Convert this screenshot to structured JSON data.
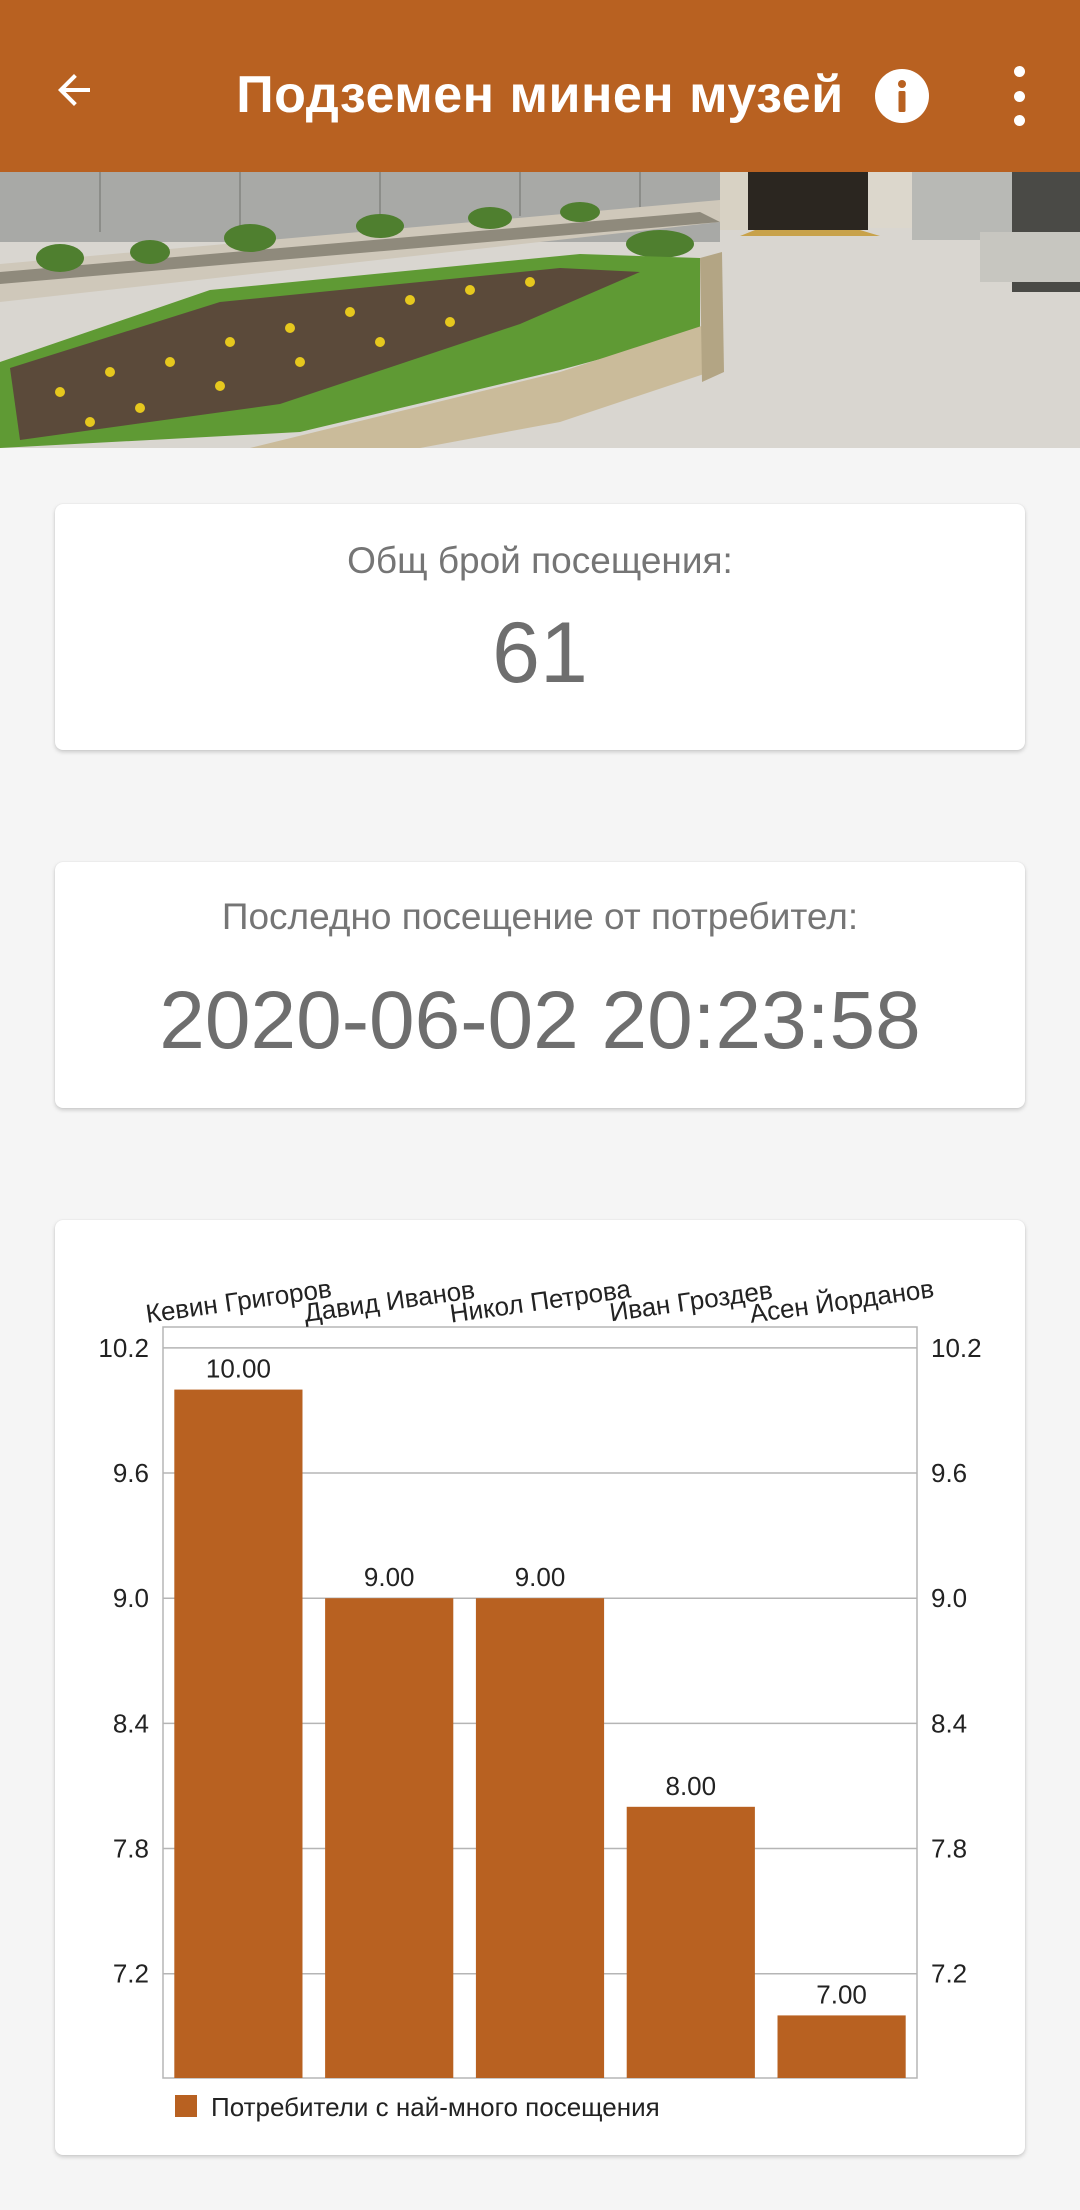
{
  "appbar": {
    "title": "Подземен минен музей",
    "back_icon": "arrow-left-icon",
    "info_icon": "info-icon",
    "more_icon": "more-vert-icon",
    "background": "#b86121"
  },
  "total_card": {
    "label": "Общ брой посещения:",
    "value": "61"
  },
  "last_visit_card": {
    "label": "Последно посещение от потребител:",
    "value": "2020-06-02 20:23:58"
  },
  "chart_data": {
    "type": "bar",
    "categories": [
      "Кевин Григоров",
      "Давид Иванов",
      "Никол Петрова",
      "Иван Гроздев",
      "Асен Йорданов"
    ],
    "series": [
      {
        "name": "Потребители с най-много посещения",
        "values": [
          10,
          9,
          9,
          8,
          7
        ],
        "value_labels": [
          "10.00",
          "9.00",
          "9.00",
          "8.00",
          "7.00"
        ],
        "color": "#b86121"
      }
    ],
    "yticks": [
      "7.2",
      "7.8",
      "8.4",
      "9.0",
      "9.6",
      "10.2"
    ],
    "ylim": [
      6.7,
      10.3
    ],
    "grid": true,
    "legend": "bottom-left",
    "category_labels_position": "top"
  }
}
